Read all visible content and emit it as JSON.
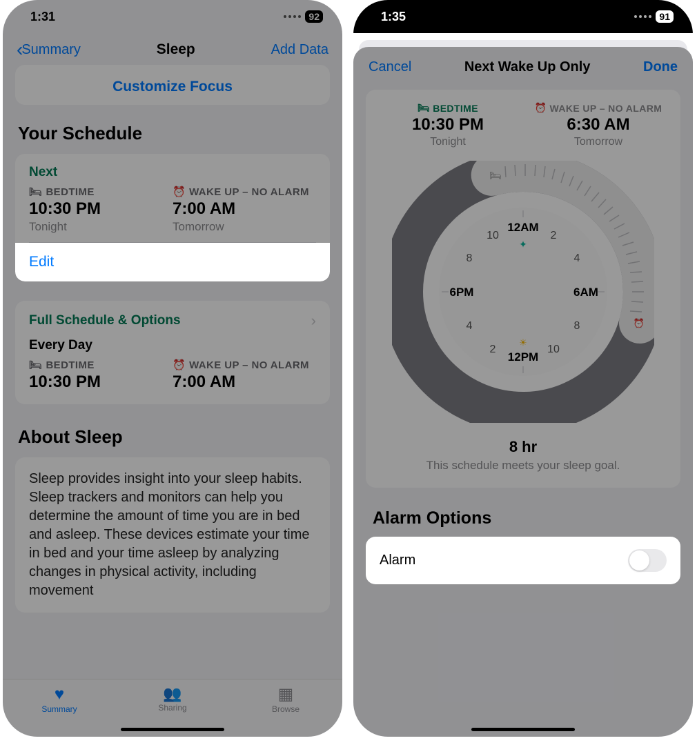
{
  "left": {
    "status": {
      "time": "1:31",
      "battery": "92"
    },
    "nav": {
      "back": "Summary",
      "title": "Sleep",
      "action": "Add Data"
    },
    "customize": "Customize Focus",
    "schedule_h": "Your Schedule",
    "next": {
      "label": "Next",
      "bed_h": "BEDTIME",
      "bed_t": "10:30 PM",
      "bed_c": "Tonight",
      "wake_h": "WAKE UP – NO ALARM",
      "wake_t": "7:00 AM",
      "wake_c": "Tomorrow"
    },
    "edit": "Edit",
    "full": {
      "label": "Full Schedule & Options",
      "every": "Every Day",
      "bed_h": "BEDTIME",
      "bed_t": "10:30 PM",
      "wake_h": "WAKE UP – NO ALARM",
      "wake_t": "7:00 AM"
    },
    "about_h": "About Sleep",
    "about_p": "Sleep provides insight into your sleep habits. Sleep trackers and monitors can help you determine the amount of time you are in bed and asleep. These devices estimate your time in bed and your time asleep by analyzing changes in physical activity, including movement",
    "tabs": {
      "summary": "Summary",
      "sharing": "Sharing",
      "browse": "Browse"
    }
  },
  "right": {
    "status": {
      "time": "1:35",
      "battery": "91"
    },
    "nav": {
      "cancel": "Cancel",
      "title": "Next Wake Up Only",
      "done": "Done"
    },
    "head": {
      "bed_h": "BEDTIME",
      "bed_t": "10:30 PM",
      "bed_c": "Tonight",
      "wake_h": "WAKE UP – NO ALARM",
      "wake_t": "6:30 AM",
      "wake_c": "Tomorrow"
    },
    "clock": {
      "h12am": "12AM",
      "h2": "2",
      "h4": "4",
      "h6am": "6AM",
      "h8": "8",
      "h10": "10",
      "h12pm": "12PM",
      "h2b": "2",
      "h4b": "4",
      "h6pm": "6PM",
      "h8b": "8",
      "h10b": "10"
    },
    "hours": "8 hr",
    "goal": "This schedule meets your sleep goal.",
    "alarm_h": "Alarm Options",
    "alarm_label": "Alarm"
  }
}
